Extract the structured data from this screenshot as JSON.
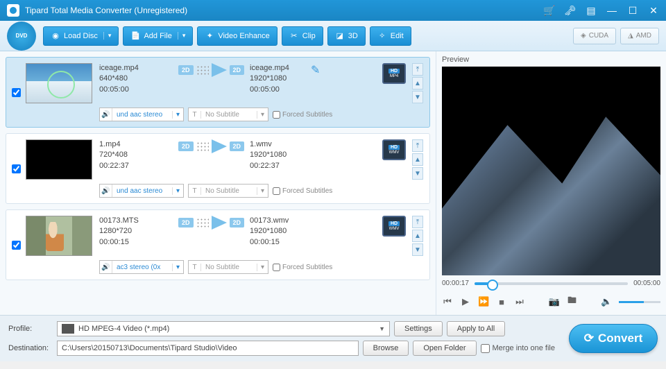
{
  "app": {
    "title": "Tipard Total Media Converter (Unregistered)",
    "logo_text": "DVD"
  },
  "toolbar": {
    "load_disc": "Load Disc",
    "add_file": "Add File",
    "video_enhance": "Video Enhance",
    "clip": "Clip",
    "三d": "3D",
    "edit": "Edit",
    "cuda": "CUDA",
    "amd": "AMD"
  },
  "files": [
    {
      "src_name": "iceage.mp4",
      "src_res": "640*480",
      "src_dur": "00:05:00",
      "dst_name": "iceage.mp4",
      "dst_res": "1920*1080",
      "dst_dur": "00:05:00",
      "audio": "und aac stereo",
      "subtitle_placeholder": "No Subtitle",
      "forced_label": "Forced Subtitles",
      "fmt_hd": "HD",
      "fmt_ext": "MP4",
      "selected": true
    },
    {
      "src_name": "1.mp4",
      "src_res": "720*408",
      "src_dur": "00:22:37",
      "dst_name": "1.wmv",
      "dst_res": "1920*1080",
      "dst_dur": "00:22:37",
      "audio": "und aac stereo",
      "subtitle_placeholder": "No Subtitle",
      "forced_label": "Forced Subtitles",
      "fmt_hd": "HD",
      "fmt_ext": "WMV",
      "selected": false
    },
    {
      "src_name": "00173.MTS",
      "src_res": "1280*720",
      "src_dur": "00:00:15",
      "dst_name": "00173.wmv",
      "dst_res": "1920*1080",
      "dst_dur": "00:00:15",
      "audio": "ac3 stereo (0x",
      "subtitle_placeholder": "No Subtitle",
      "forced_label": "Forced Subtitles",
      "fmt_hd": "HD",
      "fmt_ext": "WMV",
      "selected": false
    }
  ],
  "badge_2d": "2D",
  "preview": {
    "label": "Preview",
    "time_current": "00:00:17",
    "time_total": "00:05:00"
  },
  "bottom": {
    "profile_label": "Profile:",
    "profile_value": "HD MPEG-4 Video (*.mp4)",
    "destination_label": "Destination:",
    "destination_value": "C:\\Users\\20150713\\Documents\\Tipard Studio\\Video",
    "settings": "Settings",
    "apply_all": "Apply to All",
    "browse": "Browse",
    "open_folder": "Open Folder",
    "merge": "Merge into one file",
    "convert": "Convert"
  }
}
